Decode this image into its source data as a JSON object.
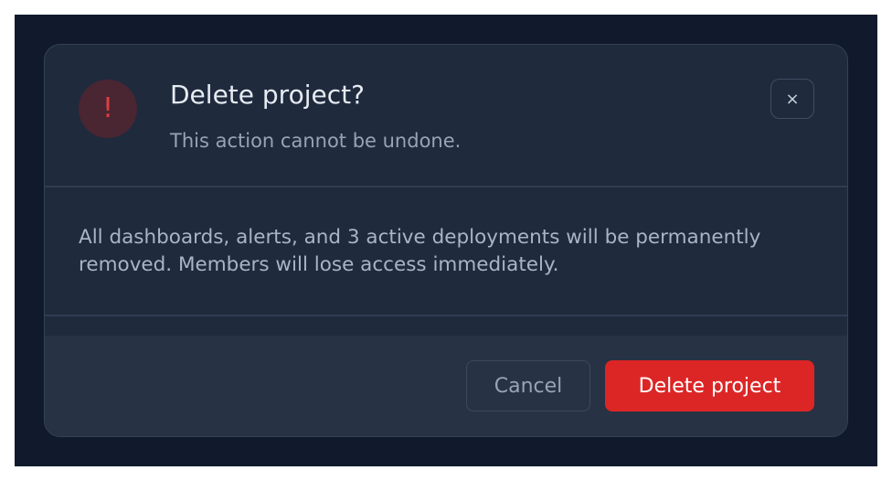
{
  "dialog": {
    "icon": "exclamation-icon",
    "icon_glyph": "!",
    "title": "Delete project?",
    "subtitle": "This action cannot be undone.",
    "close_glyph": "×",
    "body": "All dashboards, alerts, and 3 active deployments will be permanently removed. Members will lose access immediately.",
    "cancel_label": "Cancel",
    "delete_label": "Delete project"
  },
  "colors": {
    "backdrop": "#111a2c",
    "surface": "#1f2a3d",
    "footer": "#273244",
    "danger": "#dc2626",
    "danger_soft": "#4a2532"
  }
}
